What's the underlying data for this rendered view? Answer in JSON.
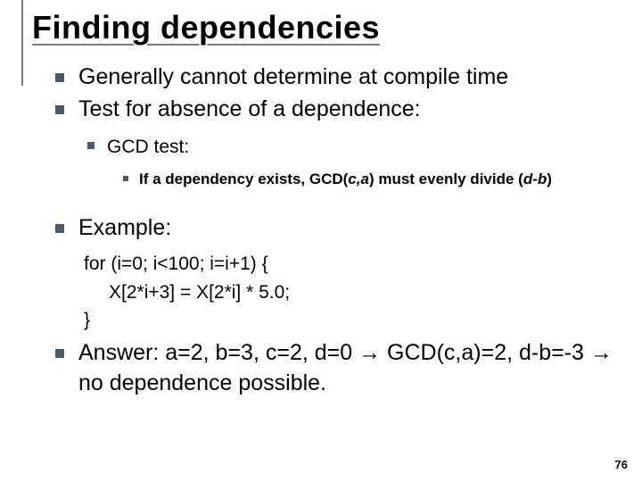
{
  "title": "Finding dependencies",
  "bullets": {
    "b1": "Generally cannot determine at compile time",
    "b2": "Test for absence of a dependence:",
    "b2_sub": "GCD test:",
    "b2_sub_sub_prefix": "If a dependency exists, GCD(",
    "b2_sub_sub_ca": "c,a",
    "b2_sub_sub_mid": ") must evenly divide (",
    "b2_sub_sub_db": "d-b",
    "b2_sub_sub_suffix": ")",
    "b3": "Example:",
    "code_l1": "for (i=0; i<100; i=i+1) {",
    "code_l2": "X[2*i+3] = X[2*i] * 5.0;",
    "code_l3": "}",
    "b4": "Answer: a=2, b=3, c=2, d=0 → GCD(c,a)=2, d-b=-3 → no dependence possible."
  },
  "page_number": "76"
}
